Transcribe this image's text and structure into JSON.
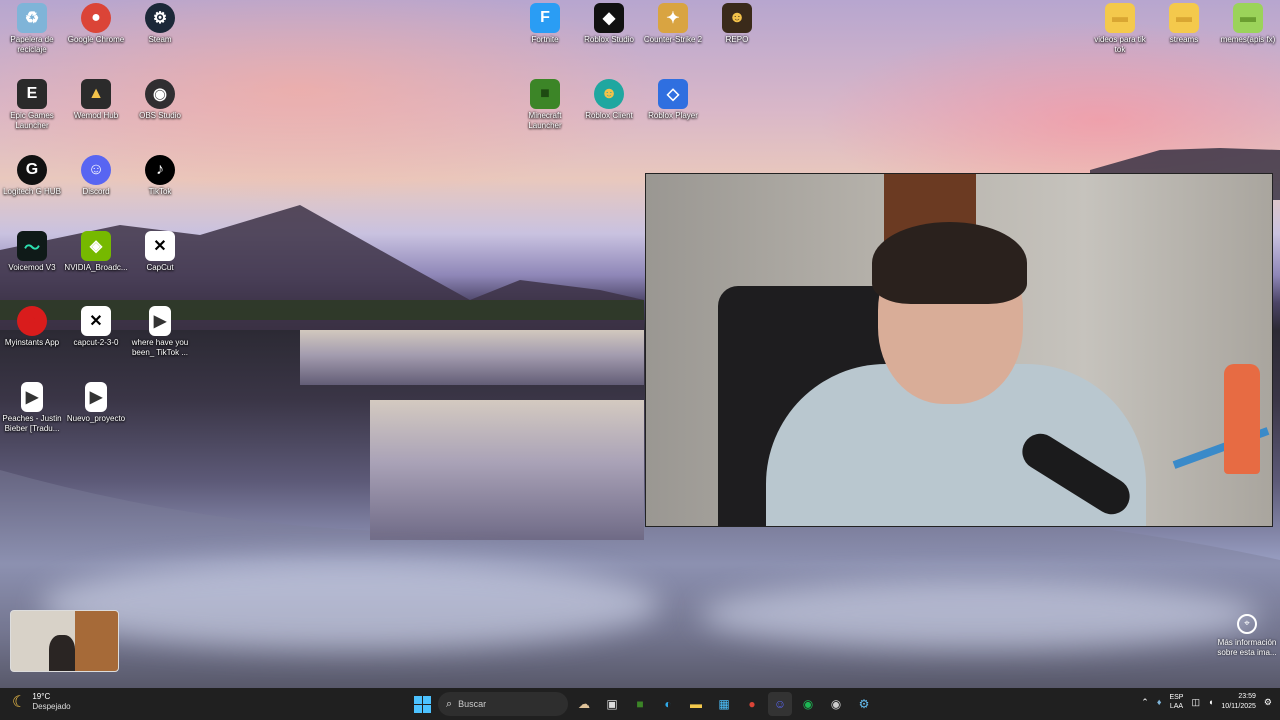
{
  "desktop_icons": [
    {
      "label": "Papelera de reciclaje",
      "icon": "recycle-bin-icon",
      "color": "#7fb4d8",
      "glyph": "♻"
    },
    {
      "label": "Google Chrome",
      "icon": "chrome-icon",
      "color": "#db4437",
      "glyph": "●"
    },
    {
      "label": "Steam",
      "icon": "steam-icon",
      "color": "#1b2838",
      "glyph": "⚙"
    },
    {
      "label": "Epic Games Launcher",
      "icon": "epic-games-icon",
      "color": "#2a2a2a",
      "glyph": "E"
    },
    {
      "label": "Wemod Hub",
      "icon": "wemod-icon",
      "color": "#2b2b2b",
      "glyph": "▲"
    },
    {
      "label": "OBS Studio",
      "icon": "obs-icon",
      "color": "#302e31",
      "glyph": "◉"
    },
    {
      "label": "Logitech G HUB",
      "icon": "logitech-icon",
      "color": "#111111",
      "glyph": "G"
    },
    {
      "label": "Discord",
      "icon": "discord-icon",
      "color": "#5865f2",
      "glyph": "☺"
    },
    {
      "label": "TikTok",
      "icon": "tiktok-icon",
      "color": "#000000",
      "glyph": "♪"
    },
    {
      "label": "Voicemod V3",
      "icon": "voicemod-icon",
      "color": "#0f1a18",
      "glyph": "〜"
    },
    {
      "label": "NVIDIA_Broadc...",
      "icon": "nvidia-icon",
      "color": "#76b900",
      "glyph": "◈"
    },
    {
      "label": "CapCut",
      "icon": "capcut-icon",
      "color": "#000000",
      "glyph": "✕"
    },
    {
      "label": "Myinstants App",
      "icon": "myinstants-icon",
      "color": "#d91c1c",
      "glyph": "●"
    },
    {
      "label": "capcut-2-3-0",
      "icon": "capcut-file-icon",
      "color": "#ffffff",
      "glyph": "✕"
    },
    {
      "label": "where have you been_ TikTok ...",
      "icon": "video-file-icon",
      "color": "#ffffff",
      "glyph": "▶"
    },
    {
      "label": "Peaches - Justin Bieber [Tradu...",
      "icon": "video-file-icon",
      "color": "#ffffff",
      "glyph": "▶"
    },
    {
      "label": "Nuevo_proyecto",
      "icon": "video-file-icon",
      "color": "#ffffff",
      "glyph": "▶"
    },
    {
      "label": "Fortnite",
      "icon": "fortnite-icon",
      "color": "#2a9df4",
      "glyph": "F"
    },
    {
      "label": "Roblox Studio",
      "icon": "roblox-studio-icon",
      "color": "#111111",
      "glyph": "◆"
    },
    {
      "label": "Counter-Strike 2",
      "icon": "cs2-icon",
      "color": "#d9a441",
      "glyph": "✦"
    },
    {
      "label": "REPO",
      "icon": "repo-icon",
      "color": "#3a2a1a",
      "glyph": "☻"
    },
    {
      "label": "Minecraft Launcher",
      "icon": "minecraft-icon",
      "color": "#3c8527",
      "glyph": "■"
    },
    {
      "label": "Roblox Client",
      "icon": "roblox-client-icon",
      "color": "#1fa7a0",
      "glyph": "☻"
    },
    {
      "label": "Roblox Player",
      "icon": "roblox-player-icon",
      "color": "#2f6fe0",
      "glyph": "◇"
    },
    {
      "label": "videos para tik tok",
      "icon": "folder-icon",
      "color": "#f4c94c",
      "glyph": "▬"
    },
    {
      "label": "streams",
      "icon": "folder-icon",
      "color": "#f4c94c",
      "glyph": "▬"
    },
    {
      "label": "memes(apis fx)",
      "icon": "folder-icon",
      "color": "#9bd35a",
      "glyph": "▬"
    }
  ],
  "spotlight": {
    "label": "Más información sobre esta ima...",
    "icon": "camera-info-icon"
  },
  "taskbar": {
    "weather_temp": "19°C",
    "weather_desc": "Despejado",
    "search_placeholder": "Buscar",
    "apps": [
      {
        "icon": "widgets-icon",
        "glyph": "☁",
        "color": "#e0c39a"
      },
      {
        "icon": "task-view-icon",
        "glyph": "▣",
        "color": "#dddddd"
      },
      {
        "icon": "minecraft-taskbar-icon",
        "glyph": "■",
        "color": "#3c8527"
      },
      {
        "icon": "edge-icon",
        "glyph": "◐",
        "color": "#2fa9e8"
      },
      {
        "icon": "file-explorer-icon",
        "glyph": "▬",
        "color": "#f4c94c"
      },
      {
        "icon": "store-icon",
        "glyph": "▦",
        "color": "#4cc2ff"
      },
      {
        "icon": "chrome-taskbar-icon",
        "glyph": "●",
        "color": "#db4437"
      },
      {
        "icon": "discord-taskbar-icon",
        "glyph": "☺",
        "color": "#5865f2"
      },
      {
        "icon": "spotify-icon",
        "glyph": "◉",
        "color": "#1db954"
      },
      {
        "icon": "obs-taskbar-icon",
        "glyph": "◉",
        "color": "#cccccc"
      },
      {
        "icon": "steam-taskbar-icon",
        "glyph": "⚙",
        "color": "#66c0f4"
      }
    ],
    "lang_line1": "ESP",
    "lang_line2": "LAA",
    "time": "23:59",
    "date": "10/11/2025"
  }
}
